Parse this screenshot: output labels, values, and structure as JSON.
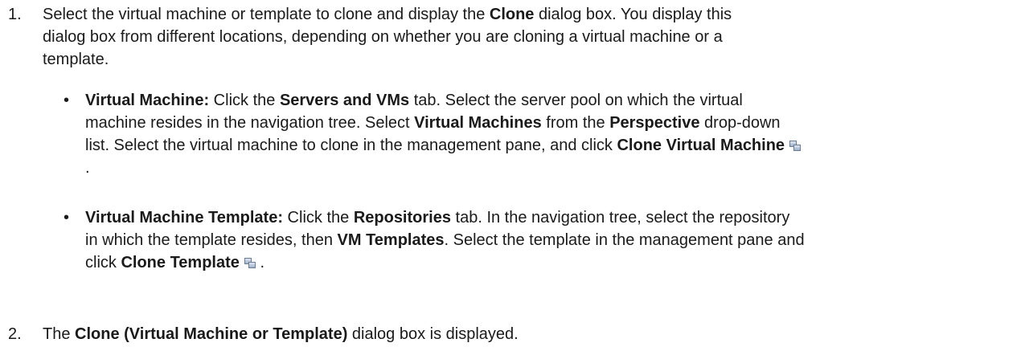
{
  "steps": [
    {
      "number": "1.",
      "intro": {
        "t1": "Select the virtual machine or template to clone and display the ",
        "b1": "Clone",
        "t2": " dialog box. You display this",
        "line2": "dialog box from different locations, depending on whether you are cloning a virtual machine or a",
        "line3": "template."
      },
      "bullets": [
        {
          "marker": "•",
          "lead": "Virtual Machine:",
          "l1_t1": " Click the ",
          "l1_b1": "Servers and VMs",
          "l1_t2": " tab. Select the server pool on which the virtual",
          "l2_t1": "machine resides in the navigation tree. Select ",
          "l2_b1": "Virtual Machines",
          "l2_t2": " from the ",
          "l2_b2": "Perspective",
          "l2_t3": " drop-down",
          "l3_t1": "list. Select the virtual machine to clone in the management pane, and click ",
          "l3_b1": "Clone Virtual Machine",
          "l3_icon": "clone-vm-icon",
          "l4": "."
        },
        {
          "marker": "•",
          "lead": "Virtual Machine Template:",
          "l1_t1": " Click the ",
          "l1_b1": "Repositories",
          "l1_t2": " tab. In the navigation tree, select the repository",
          "l2_t1": "in which the template resides, then ",
          "l2_b1": "VM Templates",
          "l2_t2": ". Select the template in the management pane and",
          "l3_t1": "click ",
          "l3_b1": "Clone Template",
          "l3_icon": "clone-template-icon",
          "l3_t2": " ."
        }
      ]
    },
    {
      "number": "2.",
      "t1": "The ",
      "b1": "Clone (Virtual Machine or Template)",
      "t2": " dialog box is displayed."
    }
  ]
}
